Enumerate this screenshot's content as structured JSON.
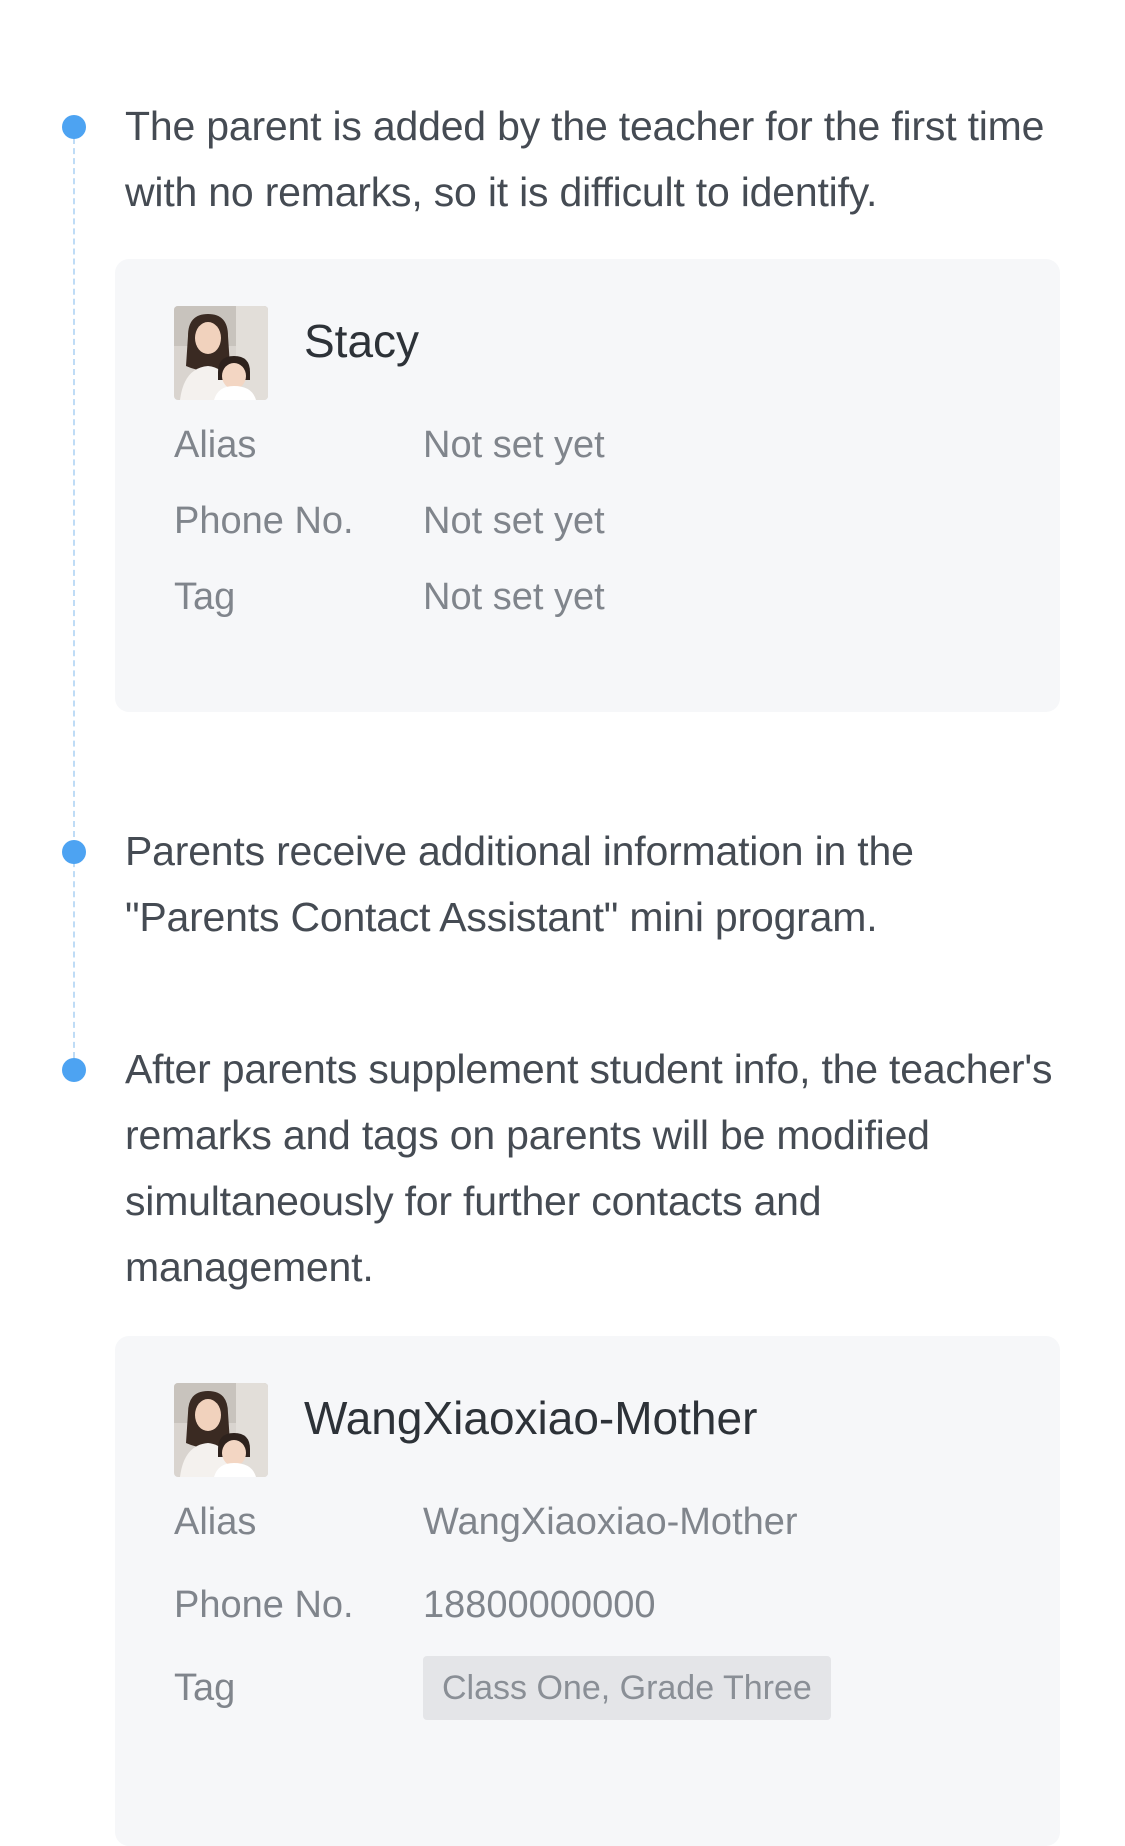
{
  "steps": [
    {
      "text": "The parent is added by the teacher for the first time with no remarks, so it is difficult to identify."
    },
    {
      "text": "Parents receive additional information in the \"Parents Contact Assistant\" mini program."
    },
    {
      "text": "After parents supplement student info, the teacher's remarks and tags on parents will be modified simultaneously for further contacts and management."
    }
  ],
  "card_before": {
    "name": "Stacy",
    "alias_label": "Alias",
    "alias_value": "Not set yet",
    "phone_label": "Phone No.",
    "phone_value": "Not set yet",
    "tag_label": "Tag",
    "tag_value": "Not set yet"
  },
  "card_after": {
    "name": "WangXiaoxiao-Mother",
    "alias_label": "Alias",
    "alias_value": "WangXiaoxiao-Mother",
    "phone_label": "Phone No.",
    "phone_value": "18800000000",
    "tag_label": "Tag",
    "tag_value": "Class One, Grade Three"
  },
  "colors": {
    "accent": "#4da3f2",
    "timeline_dash": "#bfdcf6",
    "card_bg": "#f6f7f9",
    "tag_bg": "#e4e5e8"
  },
  "icons": {
    "avatar": "parent-avatar-photo"
  }
}
